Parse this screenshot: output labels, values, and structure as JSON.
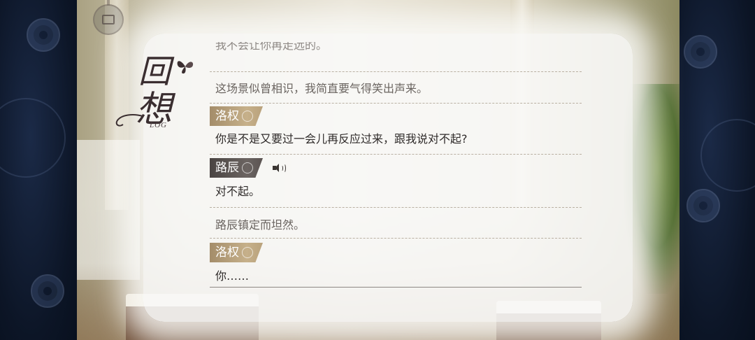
{
  "title": {
    "char1": "回",
    "char2": "想",
    "sub": "LOG"
  },
  "log": {
    "partial_line": "我不会让你再走远的。",
    "entries": [
      {
        "type": "narration",
        "text": "这场景似曾相识，我简直要气得笑出声来。"
      },
      {
        "type": "name",
        "speaker": "洛权",
        "style": "gold",
        "voice": false
      },
      {
        "type": "dialogue",
        "text": "你是不是又要过一会儿再反应过来，跟我说对不起?"
      },
      {
        "type": "name",
        "speaker": "路辰",
        "style": "dark",
        "voice": true
      },
      {
        "type": "dialogue",
        "text": "对不起。"
      },
      {
        "type": "narration",
        "text": "路辰镇定而坦然。"
      },
      {
        "type": "name",
        "speaker": "洛权",
        "style": "gold",
        "voice": false
      },
      {
        "type": "dialogue",
        "text": "你……"
      }
    ]
  },
  "icons": {
    "menu": "menu-circle-icon",
    "voice": "speaker-icon",
    "tag_rose": "rose-icon",
    "title_butterfly": "butterfly-icon"
  },
  "colors": {
    "gold_tag": "#b9a27c",
    "dark_tag": "#5b5452",
    "side_panel": "#0f1a2e"
  }
}
